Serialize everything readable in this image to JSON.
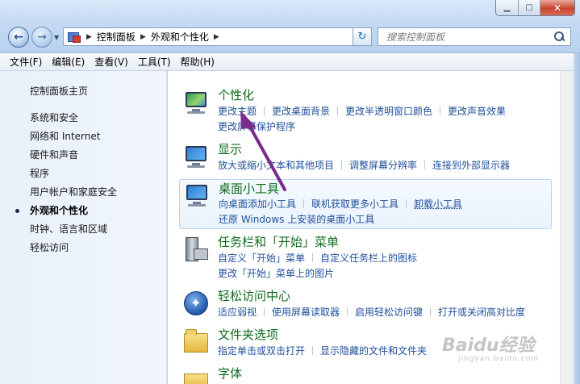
{
  "window": {
    "buttons": {
      "minimize": "▁",
      "maximize": "▢",
      "close": "✕"
    }
  },
  "address": {
    "crumbs": [
      "控制面板",
      "外观和个性化"
    ],
    "refresh_icon": "refresh-icon"
  },
  "search": {
    "placeholder": "搜索控制面板"
  },
  "menu": [
    "文件(F)",
    "编辑(E)",
    "查看(V)",
    "工具(T)",
    "帮助(H)"
  ],
  "sidebar": {
    "home": "控制面板主页",
    "items": [
      "系统和安全",
      "网络和 Internet",
      "硬件和声音",
      "程序",
      "用户帐户和家庭安全",
      "外观和个性化",
      "时钟、语言和区域",
      "轻松访问"
    ],
    "active_index": 5
  },
  "categories": [
    {
      "title": "个性化",
      "icon": "personalization-icon",
      "links": [
        "更改主题",
        "更改桌面背景",
        "更改半透明窗口颜色",
        "更改声音效果",
        "更改屏幕保护程序"
      ]
    },
    {
      "title": "显示",
      "icon": "display-icon",
      "links": [
        "放大或缩小文本和其他项目",
        "调整屏幕分辨率",
        "连接到外部显示器"
      ]
    },
    {
      "title": "桌面小工具",
      "icon": "gadgets-icon",
      "links": [
        "向桌面添加小工具",
        "联机获取更多小工具",
        "卸载小工具",
        "还原 Windows 上安装的桌面小工具"
      ]
    },
    {
      "title": "任务栏和「开始」菜单",
      "icon": "taskbar-icon",
      "links": [
        "自定义「开始」菜单",
        "自定义任务栏上的图标",
        "更改「开始」菜单上的图片"
      ]
    },
    {
      "title": "轻松访问中心",
      "icon": "ease-of-access-icon",
      "links": [
        "适应弱视",
        "使用屏幕读取器",
        "启用轻松访问键",
        "打开或关闭高对比度"
      ]
    },
    {
      "title": "文件夹选项",
      "icon": "folder-options-icon",
      "links": [
        "指定单击或双击打开",
        "显示隐藏的文件和文件夹"
      ]
    },
    {
      "title": "字体",
      "icon": "fonts-icon",
      "links": []
    }
  ],
  "watermark": {
    "text": "Baidu经验",
    "sub": "jingyan.baidu.com"
  },
  "colors": {
    "category_title": "#116a1e",
    "link": "#1f4f9a",
    "annotation_arrow": "#7a2b8e"
  }
}
